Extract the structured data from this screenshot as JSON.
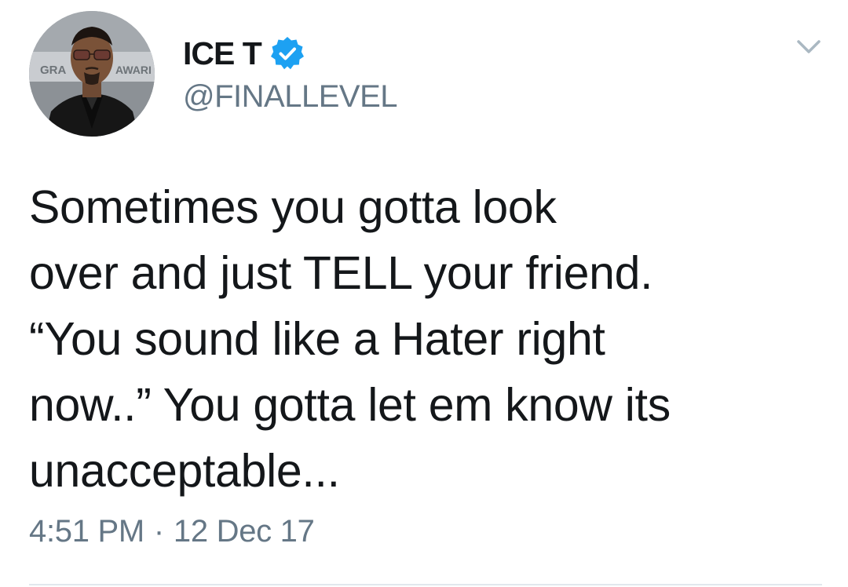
{
  "tweet": {
    "author": {
      "display_name": "ICE T",
      "handle": "@FINALLEVEL",
      "verified": true,
      "avatar": {
        "backdrop_text_left": "GRA",
        "backdrop_text_right": "AWARI"
      }
    },
    "text_lines": [
      "Sometimes you gotta look",
      "over and just TELL your friend.",
      "“You sound like a Hater right",
      "now..” You gotta let em know its",
      "unacceptable..."
    ],
    "time": "4:51 PM",
    "separator": "·",
    "date": "12 Dec 17"
  },
  "icons": {
    "verified": "verified-badge-icon",
    "more": "chevron-down-icon"
  },
  "colors": {
    "verified_blue": "#1da1f2",
    "text_primary": "#14171a",
    "text_secondary": "#657786",
    "divider": "#e1e8ed"
  }
}
